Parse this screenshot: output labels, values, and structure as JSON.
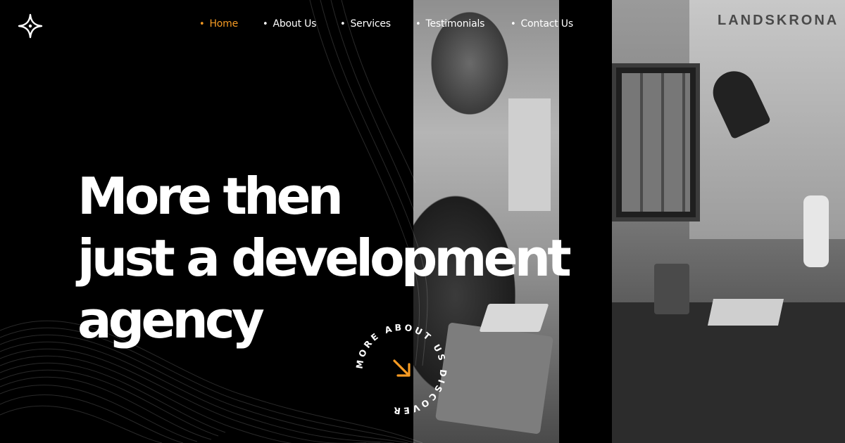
{
  "nav": {
    "logo_icon": "sparkle-star-icon",
    "items": [
      {
        "label": "Home",
        "active": true
      },
      {
        "label": "About Us",
        "active": false
      },
      {
        "label": "Services",
        "active": false
      },
      {
        "label": "Testimonials",
        "active": false
      },
      {
        "label": "Contact Us",
        "active": false
      }
    ],
    "bullet": "•"
  },
  "hero": {
    "lines": [
      "More then",
      "just a development",
      "agency"
    ]
  },
  "badge": {
    "circle_text": "MORE ABOUT US DISCOVER",
    "icon": "arrow-down-right-icon"
  },
  "photo": {
    "poster_text": "LANDSKRONA"
  },
  "colors": {
    "background": "#000000",
    "text": "#ffffff",
    "accent": "#f59a23"
  }
}
